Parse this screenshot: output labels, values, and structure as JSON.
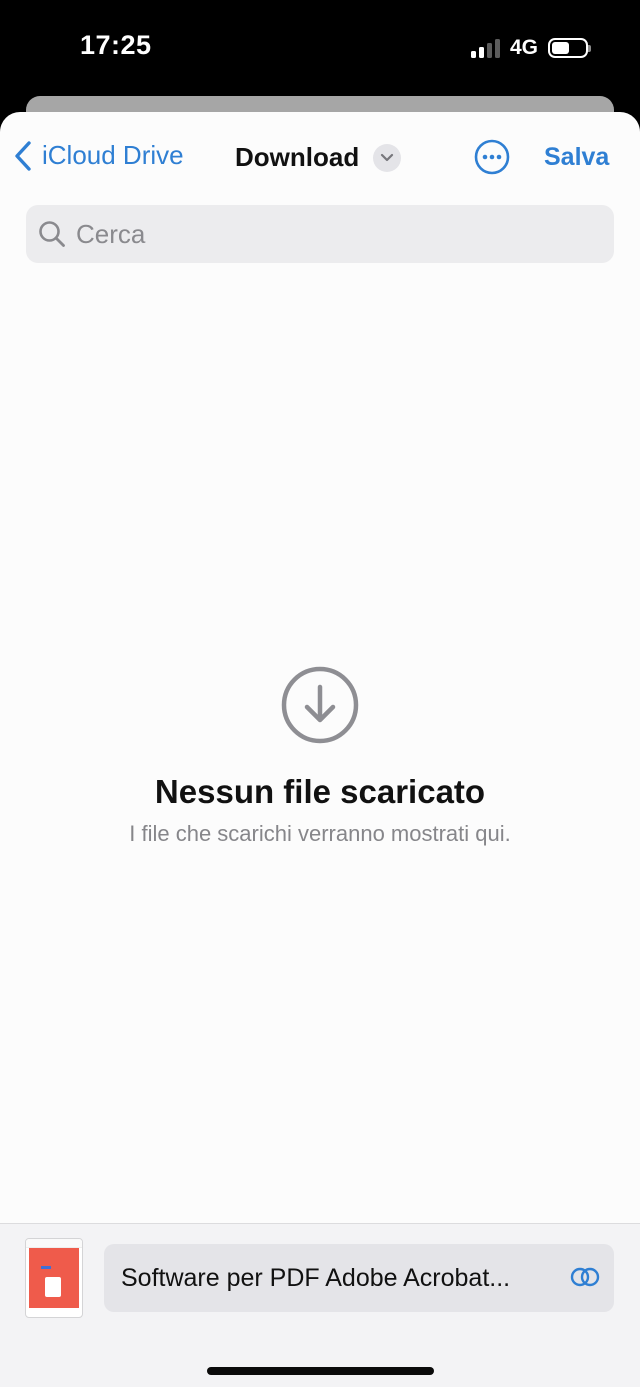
{
  "status_bar": {
    "time": "17:25",
    "network": "4G",
    "battery_fraction": 0.5,
    "signal_bars_total": 4,
    "signal_bars_active": 2
  },
  "nav": {
    "back_label": "iCloud Drive",
    "title": "Download",
    "save_label": "Salva"
  },
  "search": {
    "placeholder": "Cerca",
    "value": ""
  },
  "empty_state": {
    "icon": "download-circle-icon",
    "title": "Nessun file scaricato",
    "subtitle": "I file che scarichi verranno mostrati qui."
  },
  "bottom_bar": {
    "file_name": "Software per PDF Adobe Acrobat..."
  },
  "colors": {
    "accent": "#2f7fd3",
    "sheet_background": "#fcfcfc",
    "secondary_text": "#86868a",
    "icon_gray": "#8e8e93",
    "search_background": "#ececee"
  }
}
